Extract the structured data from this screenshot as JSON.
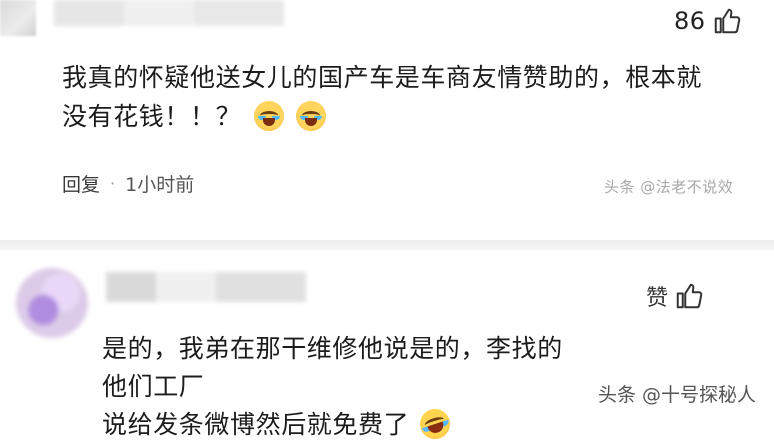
{
  "comments": [
    {
      "likes": "86",
      "text_line1": "我真的怀疑他送女儿的国产车是车商友情赞助的，根本就",
      "text_line2": "没有花钱！！？",
      "reply_label": "回复",
      "separator": "·",
      "time": "1小时前",
      "watermark": "头条 @法老不说效"
    },
    {
      "like_label": "赞",
      "text_line1": "是的，我弟在那干维修他说是的，李找的他们工厂",
      "text_line2": "说给发条微博然后就免费了"
    }
  ],
  "watermark": "头条 @十号探秘人",
  "icons": {
    "like": "thumbs-up-icon",
    "emoji1": "crying-face-icon",
    "emoji2": "laughing-crying-face-icon"
  },
  "colors": {
    "text": "#1c1c1c",
    "meta": "#555555",
    "watermark_light": "#a8a8a8",
    "divider": "#ececec"
  }
}
